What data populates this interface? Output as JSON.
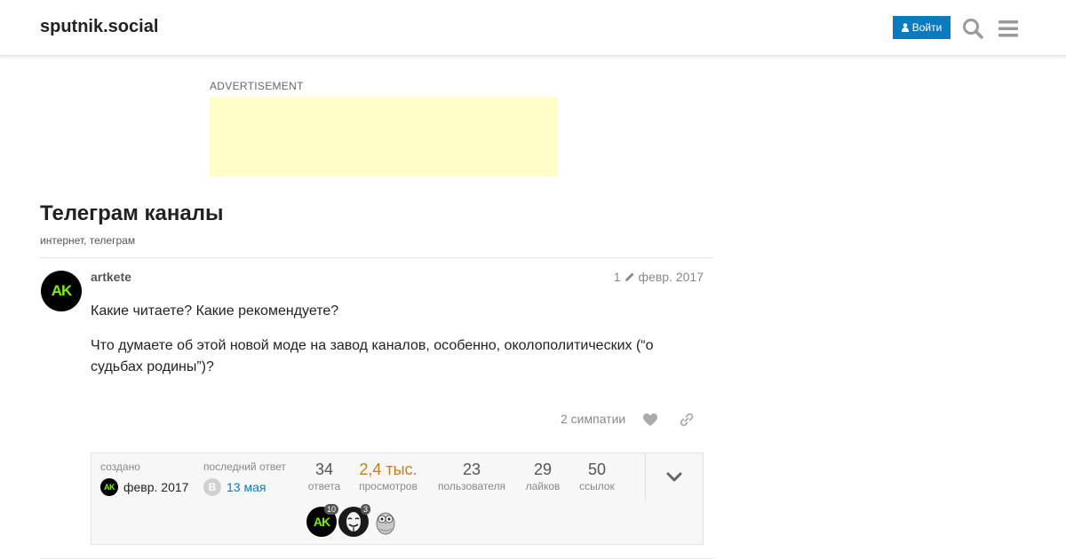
{
  "header": {
    "site_title": "sputnik.social",
    "login_label": "Войти",
    "icons": [
      "user-icon",
      "search-icon",
      "hamburger-menu-icon"
    ]
  },
  "ad": {
    "label": "ADVERTISEMENT",
    "color": "#fffdc8"
  },
  "topic": {
    "title": "Телеграм каналы",
    "tags": [
      "интернет",
      "телеграм"
    ],
    "tag_separator": ", "
  },
  "post": {
    "username": "artkete",
    "avatar_initials": "AK",
    "edit_count": "1",
    "date": "февр. 2017",
    "paragraphs": [
      "Какие читаете? Какие рекомендуете?",
      "Что думаете об этой новой моде на завод каналов, особенно, околополитических (“о судьбах родины”)?"
    ],
    "likes_text": "2 симпатии"
  },
  "topic_map": {
    "created_label": "создано",
    "created_date": "февр. 2017",
    "last_reply_label": "последний ответ",
    "last_reply_avatar": "B",
    "last_reply_date": "13 мая",
    "stats": [
      {
        "num": "34",
        "label": "ответа"
      },
      {
        "num": "2,4 тыс.",
        "label": "просмотров"
      },
      {
        "num": "23",
        "label": "пользователя"
      },
      {
        "num": "29",
        "label": "лайков"
      },
      {
        "num": "50",
        "label": "ссылок"
      }
    ],
    "participants": [
      {
        "initials": "AK",
        "count": "10"
      },
      {
        "initials": "",
        "count": "3"
      },
      {
        "initials": "",
        "count": ""
      }
    ]
  },
  "colors": {
    "accent": "#0b7bc1",
    "hot_views": "#c87d17",
    "avatar_green": "#7ff000"
  }
}
